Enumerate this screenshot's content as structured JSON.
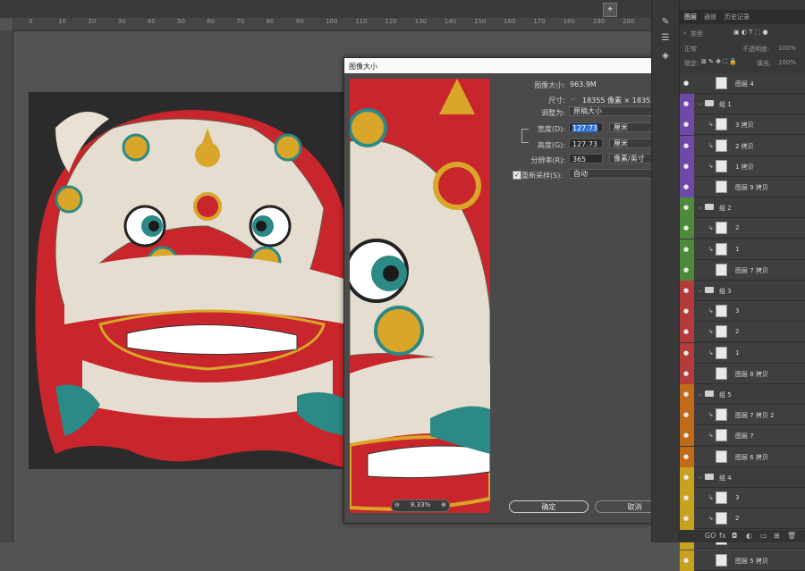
{
  "ruler": {
    "ticks": [
      "0",
      "10",
      "20",
      "30",
      "40",
      "50",
      "60",
      "70",
      "80",
      "90",
      "100",
      "110",
      "120",
      "130",
      "140",
      "150",
      "160",
      "170",
      "180",
      "190",
      "200"
    ]
  },
  "toolstrip": {
    "icons": [
      "brush-icon",
      "sliders-icon",
      "cube-icon"
    ]
  },
  "dialog": {
    "title": "图像大小",
    "close": "✕",
    "image_size_label": "图像大小:",
    "image_size_value": "963.9M",
    "gear": "⚙",
    "dimensions_label": "尺寸:",
    "dimensions_value": "18355 像素 × 18355 像素",
    "fit_label": "调整为:",
    "fit_value": "原稿大小",
    "width_label": "宽度(D):",
    "width_value": "127.73",
    "width_unit": "厘米",
    "height_label": "高度(G):",
    "height_value": "127.73",
    "height_unit": "厘米",
    "resolution_label": "分辨率(R):",
    "resolution_value": "365",
    "resolution_unit": "像素/英寸",
    "resample_label": "重新采样(S):",
    "resample_value": "自动",
    "resample_checked": true,
    "zoom_value": "8.33%",
    "ok_label": "确定",
    "cancel_label": "取消"
  },
  "panel": {
    "tabs": [
      "图层",
      "通道",
      "历史记录"
    ],
    "filter_placeholder": "类型",
    "blend_mode": "正常",
    "opacity_label": "不透明度:",
    "opacity_value": "100%",
    "lock_label": "锁定:",
    "fill_label": "填充:",
    "fill_value": "100%",
    "layers": [
      {
        "name": "图层 4",
        "type": "layer",
        "color": "#3d3d3d",
        "indent": 0
      },
      {
        "name": "组 1",
        "type": "group",
        "color": "#6e4aa8",
        "indent": 0
      },
      {
        "name": "3 拷贝",
        "type": "clip",
        "color": "#6e4aa8",
        "indent": 1
      },
      {
        "name": "2 拷贝",
        "type": "clip",
        "color": "#6e4aa8",
        "indent": 1
      },
      {
        "name": "1 拷贝",
        "type": "clip",
        "color": "#6e4aa8",
        "indent": 1
      },
      {
        "name": "图层 9 拷贝",
        "type": "layer",
        "color": "#6e4aa8",
        "indent": 1
      },
      {
        "name": "组 2",
        "type": "group",
        "color": "#4f8a3a",
        "indent": 0
      },
      {
        "name": "2",
        "type": "clip",
        "color": "#4f8a3a",
        "indent": 1
      },
      {
        "name": "1",
        "type": "clip",
        "color": "#4f8a3a",
        "indent": 1
      },
      {
        "name": "图层 7 拷贝",
        "type": "layer",
        "color": "#4f8a3a",
        "indent": 1
      },
      {
        "name": "组 3",
        "type": "group",
        "color": "#b53a3a",
        "indent": 0
      },
      {
        "name": "3",
        "type": "clip",
        "color": "#b53a3a",
        "indent": 1
      },
      {
        "name": "2",
        "type": "clip",
        "color": "#b53a3a",
        "indent": 1
      },
      {
        "name": "1",
        "type": "clip",
        "color": "#b53a3a",
        "indent": 1
      },
      {
        "name": "图层 8 拷贝",
        "type": "layer",
        "color": "#b53a3a",
        "indent": 1
      },
      {
        "name": "组 5",
        "type": "group",
        "color": "#c06a1a",
        "indent": 0
      },
      {
        "name": "图层 7 拷贝 2",
        "type": "clip",
        "color": "#c06a1a",
        "indent": 1
      },
      {
        "name": "图层 7",
        "type": "clip",
        "color": "#c06a1a",
        "indent": 1
      },
      {
        "name": "图层 6 拷贝",
        "type": "layer",
        "color": "#c06a1a",
        "indent": 1
      },
      {
        "name": "组 4",
        "type": "group",
        "color": "#c7a21e",
        "indent": 0
      },
      {
        "name": "3",
        "type": "clip",
        "color": "#c7a21e",
        "indent": 1
      },
      {
        "name": "2",
        "type": "clip",
        "color": "#c7a21e",
        "indent": 1
      },
      {
        "name": "1",
        "type": "clip",
        "color": "#c7a21e",
        "indent": 1
      },
      {
        "name": "图层 5 拷贝",
        "type": "layer",
        "color": "#c7a21e",
        "indent": 1
      }
    ],
    "footer": "GO fx"
  }
}
